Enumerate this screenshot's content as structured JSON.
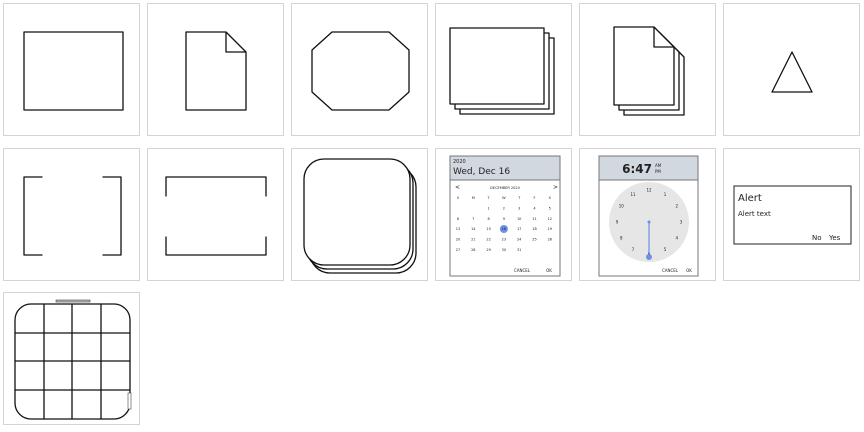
{
  "palette": {
    "tiles": [
      {
        "name": "Rectangle"
      },
      {
        "name": "Page"
      },
      {
        "name": "Octagon"
      },
      {
        "name": "Stack of rectangles"
      },
      {
        "name": "Stack of pages"
      },
      {
        "name": "Triangle"
      },
      {
        "name": "Bracket"
      },
      {
        "name": "Bracket wide"
      },
      {
        "name": "Rounded stack"
      },
      {
        "name": "Date picker"
      },
      {
        "name": "Time picker"
      },
      {
        "name": "Alert"
      },
      {
        "name": "Grid table"
      }
    ]
  },
  "date_picker": {
    "year": "2020",
    "date": "Wed, Dec 16",
    "month": "DECEMBER 2020",
    "weekdays": [
      "S",
      "M",
      "T",
      "W",
      "T",
      "F",
      "S"
    ],
    "days": [
      [
        "",
        "",
        "1",
        "2",
        "3",
        "4",
        "5"
      ],
      [
        "6",
        "7",
        "8",
        "9",
        "10",
        "11",
        "12"
      ],
      [
        "13",
        "14",
        "15",
        "16",
        "17",
        "18",
        "19"
      ],
      [
        "20",
        "21",
        "22",
        "23",
        "24",
        "25",
        "26"
      ],
      [
        "27",
        "28",
        "29",
        "30",
        "31",
        "",
        ""
      ]
    ],
    "cancel": "CANCEL",
    "ok": "OK",
    "selected_day": "16",
    "accent": "#6f8fe8"
  },
  "time_picker": {
    "time": "6:47",
    "am": "AM",
    "pm": "PM",
    "numbers": [
      "12",
      "1",
      "2",
      "3",
      "4",
      "5",
      "6",
      "7",
      "8",
      "9",
      "10",
      "11"
    ],
    "cancel": "CANCEL",
    "ok": "OK",
    "accent": "#6f8fe8"
  },
  "alert": {
    "title": "Alert",
    "text": "Alert text",
    "no": "No",
    "yes": "Yes"
  }
}
